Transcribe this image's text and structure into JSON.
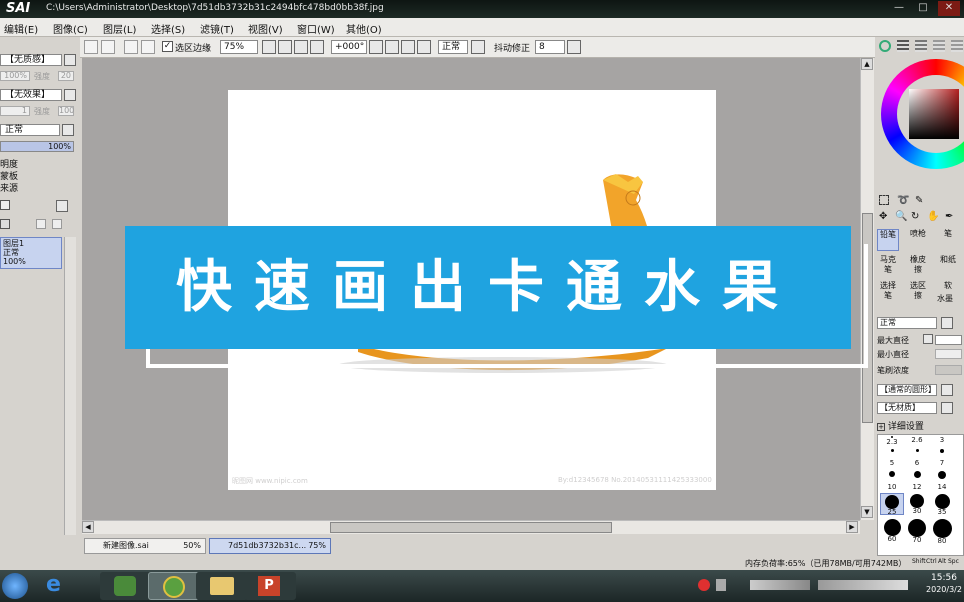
{
  "window": {
    "app_logo": "SAI",
    "path": "C:\\Users\\Administrator\\Desktop\\7d51db3732b31c2494bfc478bd0bb38f.jpg",
    "controls": [
      "—",
      "□",
      "✕"
    ]
  },
  "menubar": {
    "items": [
      "编辑(E)",
      "图像(C)",
      "图层(L)",
      "选择(S)",
      "滤镜(T)",
      "视图(V)",
      "窗口(W)",
      "其他(O)"
    ]
  },
  "left_panel": {
    "texture": "【无质感】",
    "texture_percent": "100%",
    "texture_strength": "强度",
    "texture_strength_val": "20",
    "effect": "【无效果】",
    "effect_val": "1",
    "effect_strength": "强度",
    "effect_strength_val": "100",
    "blend_mode": "正常",
    "opacity": "100%",
    "options": [
      "明度",
      "蒙板",
      "来源"
    ],
    "layer": {
      "name": "图层1",
      "mode": "正常",
      "opacity": "100%"
    }
  },
  "toolbar": {
    "selection_edge_label": "选区边缘",
    "zoom": "75%",
    "rotation": "+000°",
    "blend": "正常",
    "stabilizer_label": "抖动修正",
    "stabilizer_value": "8"
  },
  "canvas": {
    "watermark_left": "昵图网 www.nipic.com",
    "watermark_right": "By:d12345678  No.20140531111425333000"
  },
  "overlay": {
    "title": "快速画出卡通水果"
  },
  "tabs": [
    {
      "name": "新建图像.sai",
      "zoom": "50%",
      "active": false
    },
    {
      "name": "7d51db3732b31c...",
      "zoom": "75%",
      "active": true
    }
  ],
  "status": {
    "memory": "内存负荷率:65%（已用78MB/可用742MB）",
    "keys": [
      "Shift",
      "Ctrl",
      "Alt",
      "Spc"
    ]
  },
  "right_panel": {
    "tools": [
      [
        "铅笔",
        "喷枪",
        "笔"
      ],
      [
        "马克笔",
        "橡皮擦",
        "和纸"
      ],
      [
        "选择笔",
        "选区擦",
        "软"
      ],
      [
        "",
        "",
        "水墨"
      ]
    ],
    "mode": "正常",
    "max_diameter_label": "最大直径",
    "min_diameter_label": "最小直径",
    "density_label": "笔刷浓度",
    "shape": "【通常的圆形】",
    "texture": "【无材质】",
    "detail_label": "详细设置",
    "sizes": [
      "2.3",
      "2.6",
      "3",
      "",
      "",
      "",
      "5",
      "6",
      "7",
      "10",
      "12",
      "14",
      "25",
      "30",
      "35",
      "",
      "",
      "",
      "60",
      "70",
      "80"
    ]
  },
  "taskbar": {
    "time": "15:56",
    "date": "2020/3/2"
  },
  "colors": {
    "banner": "#1fa3e0",
    "canvas_bg": "#a6a4a3",
    "layer_selected": "#c7d3ef"
  }
}
